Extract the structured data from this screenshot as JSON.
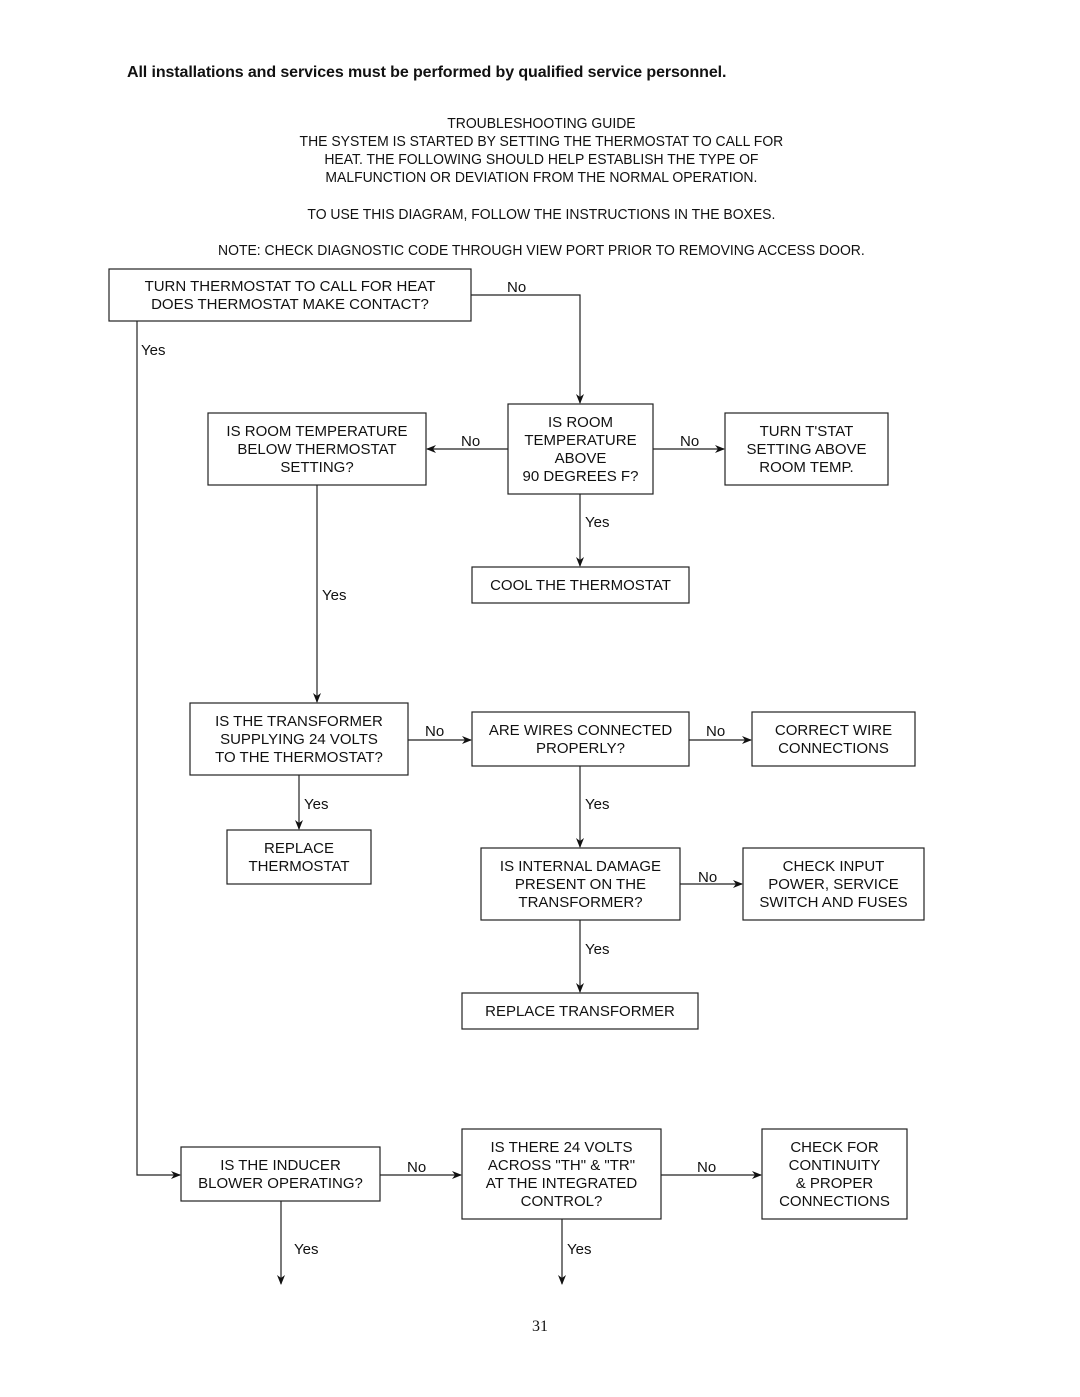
{
  "header": {
    "warning": "All installations and services must be performed by qualified service personnel."
  },
  "intro": {
    "title": "TROUBLESHOOTING GUIDE",
    "lines": [
      "THE SYSTEM IS STARTED BY SETTING THE THERMOSTAT TO CALL FOR",
      "HEAT.  THE FOLLOWING SHOULD HELP ESTABLISH THE TYPE OF",
      "MALFUNCTION OR DEVIATION FROM THE NORMAL OPERATION."
    ],
    "instruction": "TO USE THIS DIAGRAM, FOLLOW THE INSTRUCTIONS IN THE BOXES.",
    "note": "NOTE: CHECK DIAGNOSTIC CODE THROUGH VIEW PORT PRIOR TO REMOVING ACCESS DOOR."
  },
  "nodes": {
    "start": [
      "TURN THERMOSTAT TO CALL FOR HEAT",
      "DOES THERMOSTAT MAKE CONTACT?"
    ],
    "room_above_90": [
      "IS ROOM",
      "TEMPERATURE",
      "ABOVE",
      "90 DEGREES F?"
    ],
    "room_below_setting": [
      "IS ROOM TEMPERATURE",
      "BELOW THERMOSTAT",
      "SETTING?"
    ],
    "turn_tstat": [
      "TURN T'STAT",
      "SETTING ABOVE",
      "ROOM TEMP."
    ],
    "cool_thermostat": [
      "COOL THE THERMOSTAT"
    ],
    "transformer_24v": [
      "IS THE TRANSFORMER",
      "SUPPLYING 24 VOLTS",
      "TO THE THERMOSTAT?"
    ],
    "wires_connected": [
      "ARE WIRES CONNECTED",
      "PROPERLY?"
    ],
    "correct_wire": [
      "CORRECT WIRE",
      "CONNECTIONS"
    ],
    "replace_thermostat": [
      "REPLACE",
      "THERMOSTAT"
    ],
    "internal_damage": [
      "IS INTERNAL DAMAGE",
      "PRESENT ON THE",
      "TRANSFORMER?"
    ],
    "check_input": [
      "CHECK INPUT",
      "POWER, SERVICE",
      "SWITCH AND FUSES"
    ],
    "replace_transformer": [
      "REPLACE TRANSFORMER"
    ],
    "inducer": [
      "IS THE INDUCER",
      "BLOWER OPERATING?"
    ],
    "th_tr_24v": [
      "IS THERE 24 VOLTS",
      "ACROSS \"TH\" & \"TR\"",
      "AT THE INTEGRATED",
      "CONTROL?"
    ],
    "check_continuity": [
      "CHECK FOR",
      "CONTINUITY",
      "& PROPER",
      "CONNECTIONS"
    ]
  },
  "labels": {
    "yes": "Yes",
    "no": "No"
  },
  "footer": {
    "page_number": "31"
  }
}
